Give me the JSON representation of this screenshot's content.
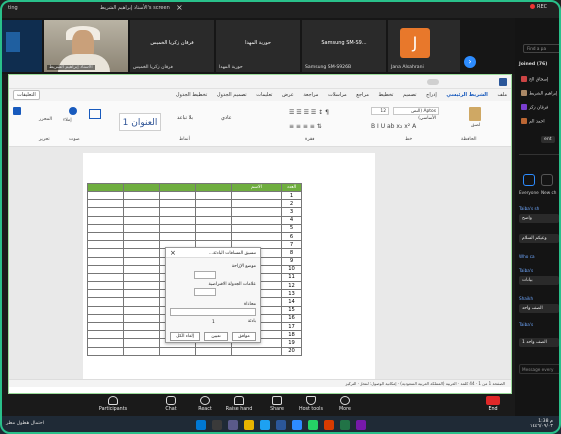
{
  "topbar": {
    "left_text": "ting",
    "share_title": "الأستاذ إبراهيم الشريط's screen",
    "rec": "REC"
  },
  "video_strip": {
    "tiles": [
      {
        "name": "فرقان زكريا الخميس"
      },
      {
        "name": "حورية المهدا"
      },
      {
        "name": "Samsung SM-S9..."
      },
      {
        "name": "Jana Alsahrani"
      }
    ],
    "cam_name": "الأستاذ إبراهيم الشريط",
    "tile_small_names": [
      "فرقان زكريا الخميس",
      "حورية المهدا",
      "Samsung SM-S926B",
      "Jana Alsahrani"
    ],
    "j_initial": "J"
  },
  "word": {
    "tabs": [
      "ملف",
      "الشريط الرئيسي",
      "إدراج",
      "تصميم",
      "تخطيط",
      "مراجع",
      "مراسلات",
      "مراجعة",
      "عرض",
      "تعليمات",
      "تصميم الجدول",
      "تخطيط الجدول"
    ],
    "active_tab": "الشريط الرئيسي",
    "comments_btn": "التعليقات",
    "font_name": "Aptos (النص الأساسي)",
    "font_size": "12",
    "groups": {
      "clipboard": "الحافظة",
      "font": "خط",
      "paragraph": "فقرة",
      "styles": "أنماط",
      "voice": "صوت",
      "editing": "تحرير"
    },
    "styles": {
      "heading1": "العنوان 1",
      "no_spacing": "بلا تباعد",
      "normal": "عادي"
    },
    "paste": "لصق",
    "dictate": "إملاء",
    "editor": "المحرر",
    "table_header": {
      "num": "العدد",
      "name": "الاسم"
    },
    "row_numbers": [
      "1",
      "2",
      "3",
      "4",
      "5",
      "6",
      "7",
      "8",
      "9",
      "10",
      "11",
      "12",
      "13",
      "14",
      "15",
      "16",
      "17",
      "18",
      "19",
      "20"
    ]
  },
  "dialog": {
    "title": "تنسيق المسافات البادئة...",
    "position_label": "موضع الإزاحة",
    "default_tab_label": "علامات الجدولة الافتراضية",
    "alignment_label": "محاذاة",
    "leader_label": "بادئة",
    "ok": "موافق",
    "cancel": "إلغاء الكل",
    "set": "تعيين",
    "num_value": "1"
  },
  "statusbar": {
    "text": "الصفحة 1 من 1 · 44 كلمة · العربية (المملكة العربية السعودية) · إمكانية الوصول: لنتحرّ · التركيز"
  },
  "zoom_toolbar": {
    "buttons": [
      "Participants",
      "Chat",
      "React",
      "Raise hand",
      "Share",
      "Host tools",
      "More"
    ],
    "participants_count": "76",
    "end": "End"
  },
  "right_panel": {
    "search_placeholder": "Find a pa",
    "joined": "Joined (76)",
    "people": [
      "إسحاق الخ",
      "إبراهيم الشريط",
      "فرقان زكر",
      "احمد الم"
    ],
    "more_btn": "ent",
    "chat_lines": [
      "Everyone",
      "New ch"
    ],
    "messages": [
      {
        "who": "Taiba's sh",
        "text": "واضح"
      },
      {
        "who": "",
        "text": "وعيكم السلام"
      },
      {
        "who": "Who ca",
        "text": ""
      },
      {
        "who": "Taiba's",
        "text": "بيانات"
      },
      {
        "who": "Shaikh",
        "text": "الصف واحد"
      },
      {
        "who": "Taiba's",
        "text": ""
      },
      {
        "who": "",
        "text": "الصف واحد 1"
      }
    ],
    "message_placeholder": "Message every"
  },
  "taskbar": {
    "weather": "احتمال هطول مطر",
    "time": "1:38 م",
    "date": "١٤٤٦/٠٩/٠٣"
  },
  "colors": {
    "zoom_blue": "#2d8cff",
    "word_blue": "#185abd",
    "table_green": "#6fae3f",
    "end_red": "#e02828",
    "avatar_orange": "#e8782b",
    "share_border": "#29c08a"
  }
}
